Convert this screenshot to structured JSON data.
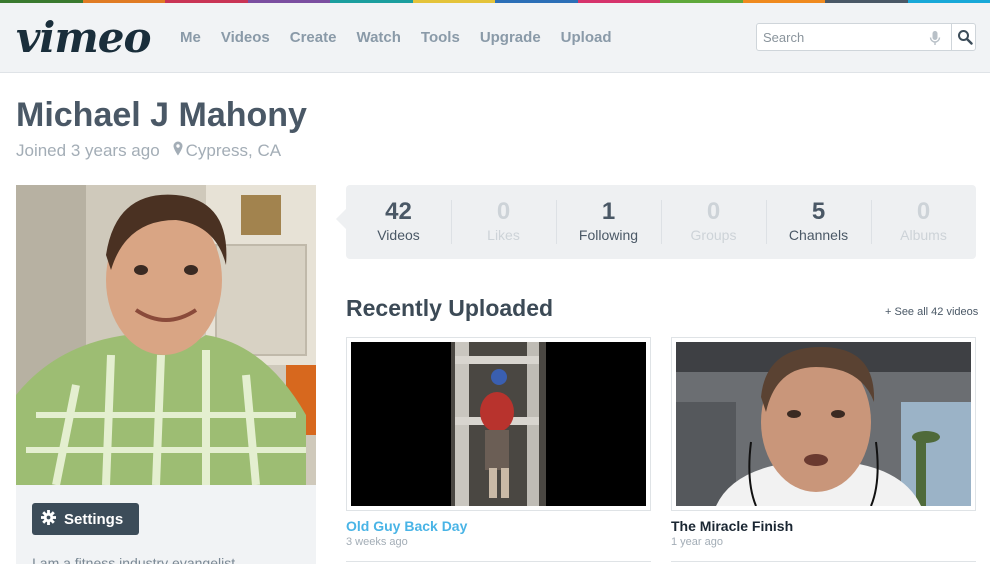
{
  "brand": {
    "logo_text": "vimeo",
    "rainbow_colors": [
      "#3a7a2f",
      "#e07b24",
      "#c93455",
      "#7b4ea0",
      "#1b9e9e",
      "#e4c33a",
      "#2c6fb7",
      "#d6336c",
      "#5fa83b",
      "#ef8a1f",
      "#4a5866",
      "#18a8d8"
    ]
  },
  "nav": {
    "items": [
      "Me",
      "Videos",
      "Create",
      "Watch",
      "Tools",
      "Upgrade",
      "Upload"
    ]
  },
  "search": {
    "placeholder": "Search",
    "mic_icon": "microphone-icon",
    "button_icon": "magnifier-icon"
  },
  "profile": {
    "name": "Michael J Mahony",
    "joined": "Joined 3 years ago",
    "location": "Cypress, CA",
    "settings_label": "Settings",
    "bio": "I am a fitness industry evangelist"
  },
  "stats": [
    {
      "count": "42",
      "label": "Videos",
      "active": true
    },
    {
      "count": "0",
      "label": "Likes",
      "active": false
    },
    {
      "count": "1",
      "label": "Following",
      "active": true
    },
    {
      "count": "0",
      "label": "Groups",
      "active": false
    },
    {
      "count": "5",
      "label": "Channels",
      "active": true
    },
    {
      "count": "0",
      "label": "Albums",
      "active": false
    }
  ],
  "recent": {
    "title": "Recently Uploaded",
    "see_all": "+ See all 42 videos",
    "videos": [
      {
        "title": "Old Guy Back Day",
        "date": "3 weeks ago"
      },
      {
        "title": "The Miracle Finish",
        "date": "1 year ago"
      }
    ]
  },
  "colors": {
    "accent_link": "#49b4e6",
    "text_dark": "#4a5866",
    "muted": "#a3adb6"
  }
}
